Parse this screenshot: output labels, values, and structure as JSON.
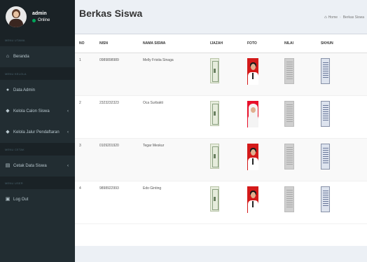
{
  "sidebar": {
    "user": {
      "name": "admin",
      "status": "Online"
    },
    "sections": [
      {
        "header": "MENU UTAMA",
        "items": [
          {
            "label": "Beranda",
            "icon": "home-icon",
            "has_arrow": false
          }
        ]
      },
      {
        "header": "MENU KELOLA",
        "items": [
          {
            "label": "Data Admin",
            "icon": "user-icon",
            "has_arrow": false
          },
          {
            "label": "Kelola Calon Siswa",
            "icon": "graduation-cap-icon",
            "has_arrow": true
          },
          {
            "label": "Kelola Jalur Pendaftaran",
            "icon": "graduation-cap-icon",
            "has_arrow": true
          }
        ]
      },
      {
        "header": "MENU CETAK",
        "items": [
          {
            "label": "Cetak Data Siswa",
            "icon": "book-icon",
            "has_arrow": true
          }
        ]
      },
      {
        "header": "MENU USER",
        "items": [
          {
            "label": "Log Out",
            "icon": "lock-icon",
            "has_arrow": false
          }
        ]
      }
    ]
  },
  "header": {
    "title": "Berkas Siswa",
    "breadcrumb": [
      "Home",
      "Berkas Siswa"
    ]
  },
  "table": {
    "columns": [
      "NO",
      "NISN",
      "NAMA SISWA",
      "IJAZAH",
      "FOTO",
      "NILAI",
      "SKHUN"
    ],
    "rows": [
      {
        "no": "1",
        "nisn": "0989898989",
        "nama": "Melly Fristia Sinaga",
        "foto": "male"
      },
      {
        "no": "2",
        "nisn": "2323232323",
        "nama": "Oca Surbakti",
        "foto": "hijab"
      },
      {
        "no": "3",
        "nisn": "0109201920",
        "nama": "Tegar Meskur",
        "foto": "male"
      },
      {
        "no": "4",
        "nisn": "9898922993",
        "nama": "Edo Ginting",
        "foto": "male"
      }
    ]
  },
  "colors": {
    "sidebar": "#222d32",
    "online": "#00a65a",
    "photo_bg": "#d41a1a"
  }
}
